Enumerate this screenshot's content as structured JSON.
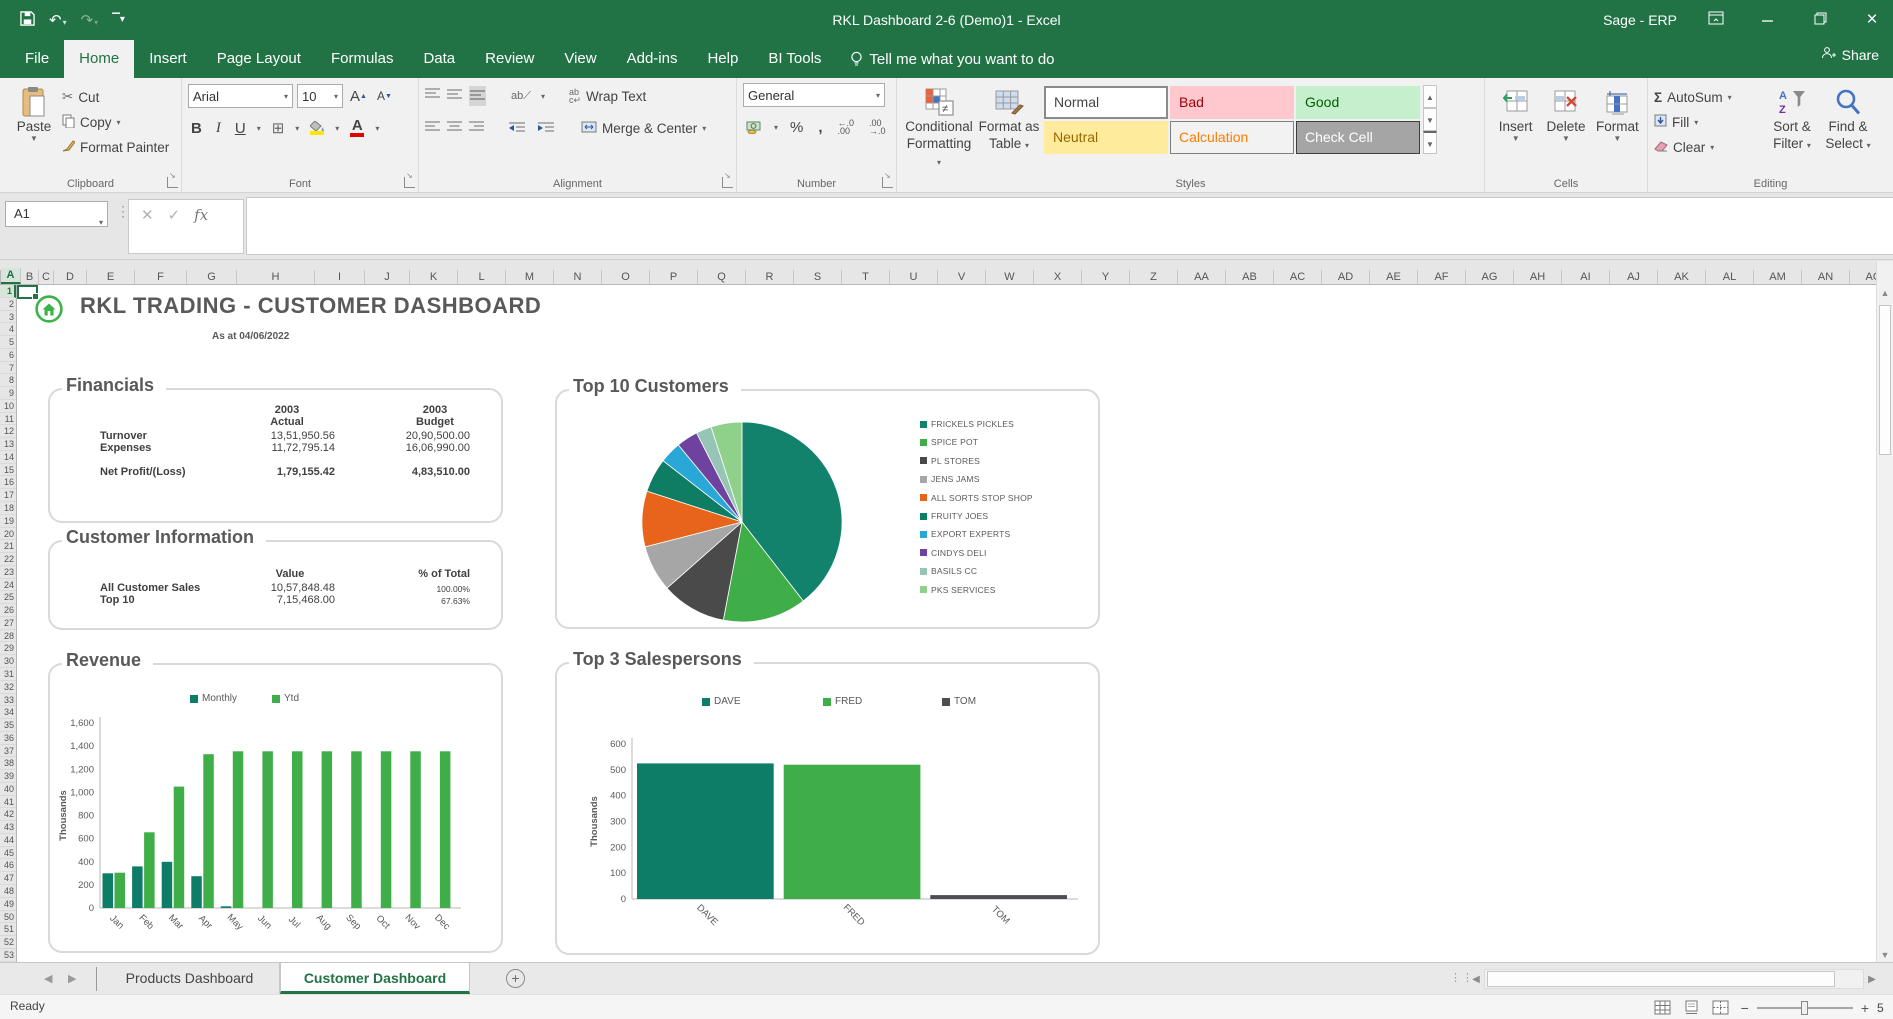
{
  "colors": {
    "excel_green": "#217346",
    "teal": "#0e7d68",
    "green": "#3fae49",
    "dark_gray_series": "#4d4d52",
    "panel_border": "#d9d9d9",
    "text_gray": "#595959"
  },
  "window": {
    "title": "RKL Dashboard 2-6 (Demo)1 -  Excel",
    "right_label": "Sage - ERP",
    "share_label": "Share"
  },
  "menu": {
    "tabs": [
      "File",
      "Home",
      "Insert",
      "Page Layout",
      "Formulas",
      "Data",
      "Review",
      "View",
      "Add-ins",
      "Help",
      "BI Tools"
    ],
    "active": "Home",
    "tell_me": "Tell me what you want to do"
  },
  "ribbon": {
    "clipboard": {
      "label": "Clipboard",
      "paste": "Paste",
      "cut": "Cut",
      "copy": "Copy",
      "format_painter": "Format Painter"
    },
    "font": {
      "label": "Font",
      "family": "Arial",
      "size": "10"
    },
    "alignment": {
      "label": "Alignment",
      "wrap_text": "Wrap Text",
      "merge_center": "Merge & Center"
    },
    "number": {
      "label": "Number",
      "format": "General"
    },
    "styles": {
      "label": "Styles",
      "conditional_1": "Conditional",
      "conditional_2": "Formatting",
      "format_table_1": "Format as",
      "format_table_2": "Table",
      "gallery": [
        {
          "name": "Normal",
          "bg": "#ffffff",
          "fg": "#444444",
          "border": "#8a8a8a",
          "selected": true
        },
        {
          "name": "Bad",
          "bg": "#ffc7ce",
          "fg": "#9c0006",
          "border": "#ffc7ce",
          "selected": false
        },
        {
          "name": "Good",
          "bg": "#c6efce",
          "fg": "#006100",
          "border": "#c6efce",
          "selected": false
        },
        {
          "name": "Neutral",
          "bg": "#ffeb9c",
          "fg": "#9c6500",
          "border": "#ffeb9c",
          "selected": false
        },
        {
          "name": "Calculation",
          "bg": "#f2f2f2",
          "fg": "#fa7d00",
          "border": "#7f7f7f",
          "selected": false
        },
        {
          "name": "Check Cell",
          "bg": "#a5a5a5",
          "fg": "#ffffff",
          "border": "#3f3f3f",
          "selected": false
        }
      ]
    },
    "cells": {
      "label": "Cells",
      "items": [
        "Insert",
        "Delete",
        "Format"
      ]
    },
    "editing": {
      "label": "Editing",
      "autosum": "AutoSum",
      "fill": "Fill",
      "clear": "Clear",
      "sort_1": "Sort &",
      "sort_2": "Filter",
      "find_1": "Find &",
      "find_2": "Select"
    }
  },
  "formula_bar": {
    "name_box": "A1",
    "value": ""
  },
  "grid": {
    "columns": [
      "A",
      "B",
      "C",
      "D",
      "E",
      "F",
      "G",
      "H",
      "I",
      "J",
      "K",
      "L",
      "M",
      "N",
      "O",
      "P",
      "Q",
      "R",
      "S",
      "T",
      "U",
      "V",
      "W",
      "X",
      "Y",
      "Z",
      "AA",
      "AB",
      "AC",
      "AD",
      "AE",
      "AF",
      "AG",
      "AH",
      "AI",
      "AJ",
      "AK",
      "AL",
      "AM",
      "AN",
      "AO"
    ],
    "row_count": 53,
    "selected_cell": "A1",
    "selected_column": "A",
    "selected_row": "1"
  },
  "dashboard": {
    "title": "RKL TRADING - CUSTOMER DASHBOARD",
    "as_at": "As at 04/06/2022",
    "financials": {
      "title": "Financials",
      "col1_header_line1": "2003",
      "col1_header_line2": "Actual",
      "col2_header_line1": "2003",
      "col2_header_line2": "Budget",
      "rows": [
        {
          "label": "Turnover",
          "actual": "13,51,950.56",
          "budget": "20,90,500.00",
          "bold": false
        },
        {
          "label": "Expenses",
          "actual": "11,72,795.14",
          "budget": "16,06,990.00",
          "bold": false
        },
        {
          "label": "Net Profit/(Loss)",
          "actual": "1,79,155.42",
          "budget": "4,83,510.00",
          "bold": true
        }
      ]
    },
    "customer_info": {
      "title": "Customer Information",
      "value_header": "Value",
      "pct_header": "% of Total",
      "rows": [
        {
          "label": "All Customer Sales",
          "value": "10,57,848.48",
          "pct": "100.00%"
        },
        {
          "label": "Top 10",
          "value": "7,15,468.00",
          "pct": "67.63%"
        }
      ]
    }
  },
  "chart_data": [
    {
      "id": "top10_pie",
      "type": "pie",
      "title": "Top 10 Customers",
      "labels": [
        "FRICKELS PICKLES",
        "SPICE POT",
        "PL STORES",
        "JENS JAMS",
        "ALL SORTS STOP SHOP",
        "FRUITY JOES",
        "EXPORT EXPERTS",
        "CINDYS DELI",
        "BASILS CC",
        "PKS SERVICES"
      ],
      "values": [
        39.5,
        13.5,
        10.5,
        7.5,
        9,
        5.5,
        3.5,
        3.5,
        2.5,
        5
      ],
      "values_are_estimated_pct": true,
      "colors": [
        "#12826c",
        "#3fae49",
        "#4a4a4a",
        "#a6a6a6",
        "#e8641b",
        "#0f7c64",
        "#29a8d8",
        "#6f42a0",
        "#96c5b5",
        "#8fd18a"
      ],
      "legend_position": "right"
    },
    {
      "id": "revenue",
      "type": "bar",
      "title": "Revenue",
      "categories": [
        "Jan",
        "Feb",
        "Mar",
        "Apr",
        "May",
        "Jun",
        "Jul",
        "Aug",
        "Sep",
        "Oct",
        "Nov",
        "Dec"
      ],
      "series": [
        {
          "name": "Monthly",
          "color": "#0e7d68",
          "values": [
            300,
            360,
            400,
            275,
            15,
            0,
            0,
            0,
            0,
            0,
            0,
            0
          ]
        },
        {
          "name": "Ytd",
          "color": "#3fae49",
          "values": [
            305,
            655,
            1050,
            1330,
            1355,
            1355,
            1355,
            1355,
            1355,
            1355,
            1355,
            1355
          ]
        }
      ],
      "values_are_estimated": true,
      "ylabel": "Thousands",
      "ylim": [
        0,
        1600
      ],
      "ytick_step": 200,
      "legend_position": "top",
      "grid": false
    },
    {
      "id": "salespersons",
      "type": "bar",
      "title": "Top 3 Salespersons",
      "categories": [
        "DAVE",
        "FRED",
        "TOM"
      ],
      "bars": [
        {
          "name": "DAVE",
          "color": "#0e7d68",
          "value": 525
        },
        {
          "name": "FRED",
          "color": "#3fae49",
          "value": 520
        },
        {
          "name": "TOM",
          "color": "#4d4d52",
          "value": 15
        }
      ],
      "values_are_estimated": true,
      "ylabel": "Thousands",
      "ylim": [
        0,
        600
      ],
      "ytick_step": 100,
      "legend_position": "top",
      "grid": false
    }
  ],
  "sheet_tabs": {
    "tabs": [
      "Products Dashboard",
      "Customer Dashboard"
    ],
    "active": "Customer Dashboard"
  },
  "status_bar": {
    "status": "Ready",
    "zoom_pct_partial": "5"
  }
}
